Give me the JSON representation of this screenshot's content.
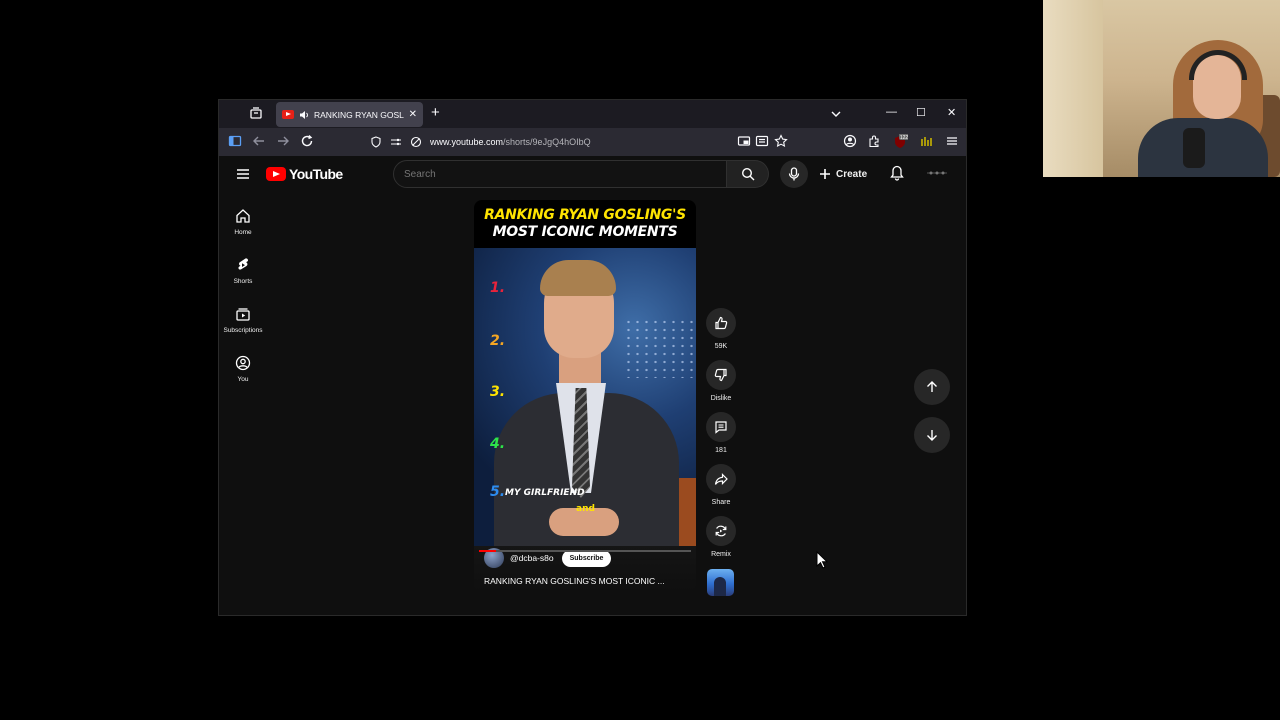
{
  "browser": {
    "tab_title": "RANKING RYAN GOSLING'S MOST ICONIC MOMENTS",
    "new_tab_symbol": "+",
    "tab_close_symbol": "✕",
    "url_host": "www.youtube.com",
    "url_path": "/shorts/9eJgQ4hOIbQ",
    "badge_count": "122",
    "window_controls": {
      "minimize": "—",
      "maximize": "☐",
      "close": "✕"
    }
  },
  "youtube": {
    "logo_text": "YouTube",
    "search_placeholder": "Search",
    "create_label": "Create",
    "sidebar": [
      {
        "label": "Home",
        "icon": "home-icon"
      },
      {
        "label": "Shorts",
        "icon": "shorts-icon"
      },
      {
        "label": "Subscriptions",
        "icon": "subscriptions-icon"
      },
      {
        "label": "You",
        "icon": "you-icon"
      }
    ],
    "short": {
      "title_line1": "RANKING RYAN GOSLING'S",
      "title_line2": "MOST ICONIC MOMENTS",
      "ranks": [
        "1.",
        "2.",
        "3.",
        "4.",
        "5."
      ],
      "rank_colors": [
        "#e8233b",
        "#f5a623",
        "#ffe400",
        "#2ee34a",
        "#2d8cf0"
      ],
      "caption_line1": "MY GIRLFRIEND",
      "caption_line2": "and",
      "channel_handle": "@dcba-s8o",
      "subscribe_label": "Subscribe",
      "video_title": "RANKING RYAN GOSLING'S MOST ICONIC ...",
      "progress": 0.08
    },
    "actions": {
      "likes": "59K",
      "dislike": "Dislike",
      "comments": "181",
      "share": "Share",
      "remix": "Remix"
    }
  }
}
